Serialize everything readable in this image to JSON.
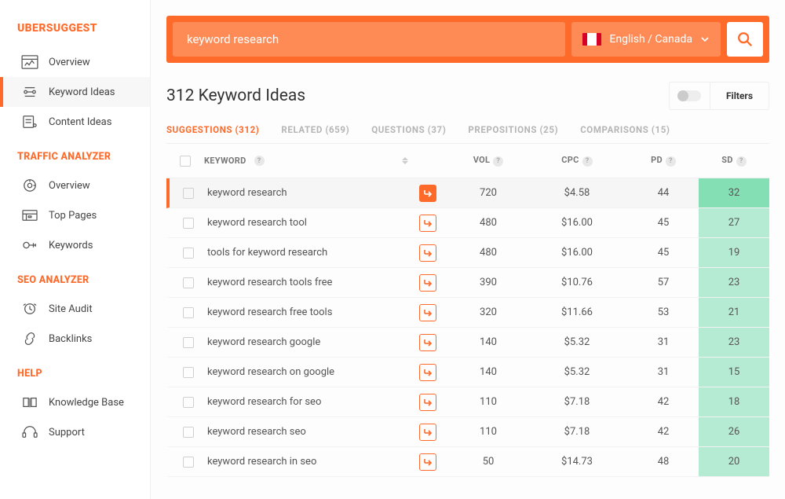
{
  "brand": "UBERSUGGEST",
  "sidebar": {
    "sections": [
      {
        "label": null,
        "items": [
          {
            "name": "overview",
            "label": "Overview"
          },
          {
            "name": "keyword-ideas",
            "label": "Keyword Ideas",
            "active": true
          },
          {
            "name": "content-ideas",
            "label": "Content Ideas"
          }
        ]
      },
      {
        "label": "TRAFFIC ANALYZER",
        "items": [
          {
            "name": "traffic-overview",
            "label": "Overview"
          },
          {
            "name": "top-pages",
            "label": "Top Pages"
          },
          {
            "name": "keywords",
            "label": "Keywords"
          }
        ]
      },
      {
        "label": "SEO ANALYZER",
        "items": [
          {
            "name": "site-audit",
            "label": "Site Audit"
          },
          {
            "name": "backlinks",
            "label": "Backlinks"
          }
        ]
      },
      {
        "label": "HELP",
        "items": [
          {
            "name": "knowledge-base",
            "label": "Knowledge Base"
          },
          {
            "name": "support",
            "label": "Support"
          }
        ]
      }
    ]
  },
  "search": {
    "value": "keyword research",
    "locale": "English / Canada"
  },
  "page_title": "312 Keyword Ideas",
  "filters_label": "Filters",
  "tabs": [
    {
      "label": "SUGGESTIONS (312)",
      "active": true
    },
    {
      "label": "RELATED (659)"
    },
    {
      "label": "QUESTIONS (37)"
    },
    {
      "label": "PREPOSITIONS (25)"
    },
    {
      "label": "COMPARISONS (15)"
    }
  ],
  "columns": {
    "keyword": "KEYWORD",
    "vol": "VOL",
    "cpc": "CPC",
    "pd": "PD",
    "sd": "SD"
  },
  "rows": [
    {
      "keyword": "keyword research",
      "vol": "720",
      "cpc": "$4.58",
      "pd": "44",
      "sd": "32",
      "selected": true
    },
    {
      "keyword": "keyword research tool",
      "vol": "480",
      "cpc": "$16.00",
      "pd": "45",
      "sd": "27"
    },
    {
      "keyword": "tools for keyword research",
      "vol": "480",
      "cpc": "$16.00",
      "pd": "45",
      "sd": "19"
    },
    {
      "keyword": "keyword research tools free",
      "vol": "390",
      "cpc": "$10.76",
      "pd": "57",
      "sd": "23"
    },
    {
      "keyword": "keyword research free tools",
      "vol": "320",
      "cpc": "$11.66",
      "pd": "53",
      "sd": "21"
    },
    {
      "keyword": "keyword research google",
      "vol": "140",
      "cpc": "$5.32",
      "pd": "31",
      "sd": "23"
    },
    {
      "keyword": "keyword research on google",
      "vol": "140",
      "cpc": "$5.32",
      "pd": "31",
      "sd": "15"
    },
    {
      "keyword": "keyword research for seo",
      "vol": "110",
      "cpc": "$7.18",
      "pd": "42",
      "sd": "18"
    },
    {
      "keyword": "keyword research seo",
      "vol": "110",
      "cpc": "$7.18",
      "pd": "42",
      "sd": "26"
    },
    {
      "keyword": "keyword research in seo",
      "vol": "50",
      "cpc": "$14.73",
      "pd": "48",
      "sd": "20"
    }
  ]
}
